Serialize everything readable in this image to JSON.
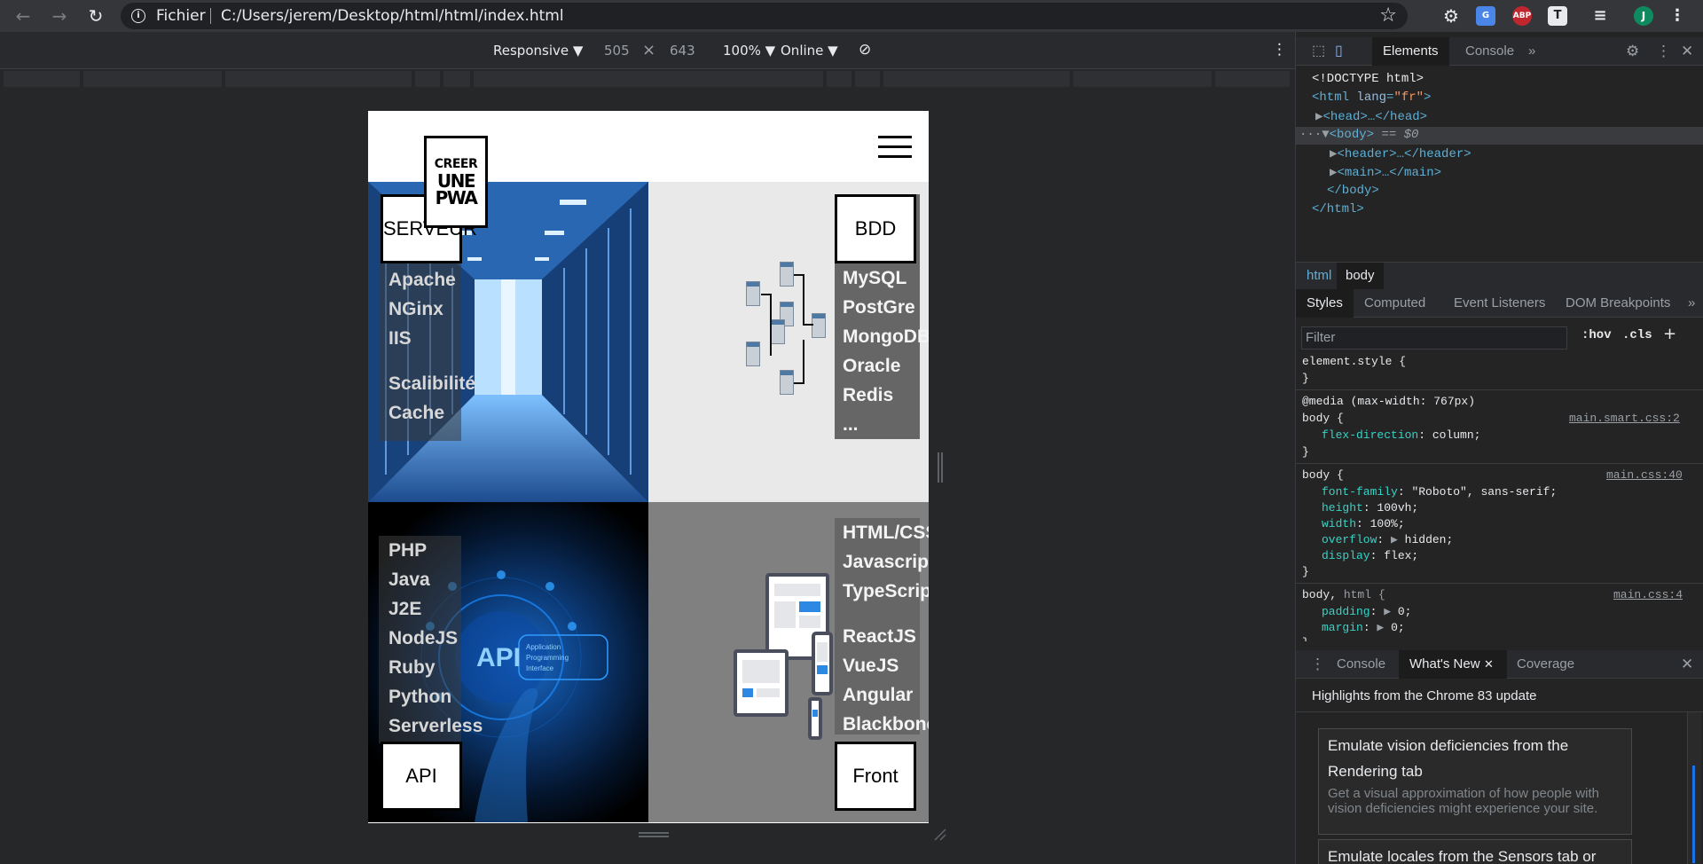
{
  "browser": {
    "scheme_label": "Fichier",
    "url": "C:/Users/jerem/Desktop/html/html/index.html",
    "extensions": [
      "ABP",
      "T",
      "J"
    ]
  },
  "device_toolbar": {
    "device": "Responsive ▼",
    "width": "505",
    "times": "×",
    "height": "643",
    "zoom": "100% ▼",
    "network": "Online ▼"
  },
  "page": {
    "logo": {
      "line1": "CREER",
      "line2": "UNE",
      "line3": "PWA"
    },
    "sections": {
      "serveur": {
        "label": "SERVEUR",
        "items": [
          "Apache",
          "NGinx",
          "IIS"
        ],
        "extra": [
          "Scalibilité",
          "Cache"
        ]
      },
      "bdd": {
        "label": "BDD",
        "items": [
          "MySQL",
          "PostGre",
          "MongoDB",
          "Oracle",
          "Redis",
          "..."
        ]
      },
      "api": {
        "label": "API",
        "items": [
          "PHP",
          "Java",
          "J2E",
          "NodeJS",
          "Ruby",
          "Python",
          "Serverless"
        ],
        "image_text": {
          "big": "API",
          "small1": "Application",
          "small2": "Programming",
          "small3": "Interface"
        }
      },
      "front": {
        "label": "Front",
        "items": [
          "HTML/CSS",
          "Javascript",
          "TypeScript"
        ],
        "extra": [
          "ReactJS",
          "VueJS",
          "Angular",
          "Blackbone"
        ]
      }
    }
  },
  "devtools": {
    "tabs": [
      "Elements",
      "Console",
      "»"
    ],
    "dom": {
      "doctype": "<!DOCTYPE html>",
      "html_open": "<html ",
      "lang_attr": "lang",
      "lang_val": "\"fr\"",
      "head": "<head>…</head>",
      "body": "<body>",
      "body_marker": "== $0",
      "header": "<header>…</header>",
      "main": "<main>…</main>",
      "body_close": "</body>",
      "html_close": "</html>"
    },
    "breadcrumbs": [
      "html",
      "body"
    ],
    "style_tabs": [
      "Styles",
      "Computed",
      "Event Listeners",
      "DOM Breakpoints",
      "»"
    ],
    "filter_placeholder": "Filter",
    "filter_buttons": [
      ":hov",
      ".cls",
      "+"
    ],
    "rules": {
      "element_style": "element.style {",
      "close": "}",
      "media": "@media (max-width: 767px)",
      "body_sel": "body {",
      "src1": "main.smart.css:2",
      "r1_prop": "flex-direction",
      "r1_val": "column;",
      "src2": "main.css:40",
      "r2": [
        {
          "p": "font-family",
          "v": "\"Roboto\", sans-serif;"
        },
        {
          "p": "height",
          "v": "100vh;"
        },
        {
          "p": "width",
          "v": "100%;"
        },
        {
          "p": "overflow",
          "v": "hidden;"
        },
        {
          "p": "display",
          "v": "flex;"
        }
      ],
      "body_html_sel": "body,",
      "body_html_sel2": " html {",
      "src3": "main.css:4",
      "r3": [
        {
          "p": "padding",
          "v": "0;"
        },
        {
          "p": "margin",
          "v": "0;"
        }
      ]
    },
    "drawer_tabs": [
      "Console",
      "What's New",
      "Coverage"
    ],
    "whats_new_title": "Highlights from the Chrome 83 update",
    "cards": [
      {
        "title": "Emulate vision deficiencies from the Rendering tab",
        "desc": "Get a visual approximation of how people with vision deficiencies might experience your site."
      },
      {
        "title": "Emulate locales from the Sensors tab or",
        "desc": ""
      }
    ]
  }
}
